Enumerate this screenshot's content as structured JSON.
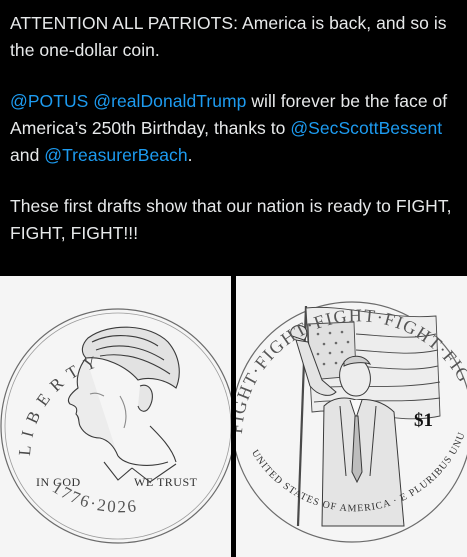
{
  "tweet": {
    "line1": "ATTENTION ALL PATRIOTS: America is back, and so is the one-dollar coin.",
    "mention_potus": "@POTUS",
    "mention_trump": "@realDonaldTrump",
    "text_mid": " will forever be the face of America’s 250th Birthday, thanks to ",
    "mention_bessent": "@SecScottBessent",
    "text_and": " and ",
    "mention_beach": "@TreasurerBeach",
    "text_end": ".",
    "line3": "These first drafts show that our nation is ready to FIGHT, FIGHT, FIGHT!!!"
  },
  "coin_front": {
    "liberty_letters": [
      "L",
      "I",
      "B",
      "E",
      "R",
      "T",
      "Y"
    ],
    "motto_left": "IN GOD",
    "motto_right": "WE TRUST",
    "years": "1776·2026"
  },
  "coin_back": {
    "top_text": "FIGHT·FIGHT·FIGHT·FIGHT·FIGHT",
    "bottom_text": "UNITED STATES OF AMERICA · E PLURIBUS UNUM",
    "denomination": "$1"
  },
  "colors": {
    "link": "#1d9bf0",
    "text": "#e7e9ea",
    "background": "#000000"
  }
}
